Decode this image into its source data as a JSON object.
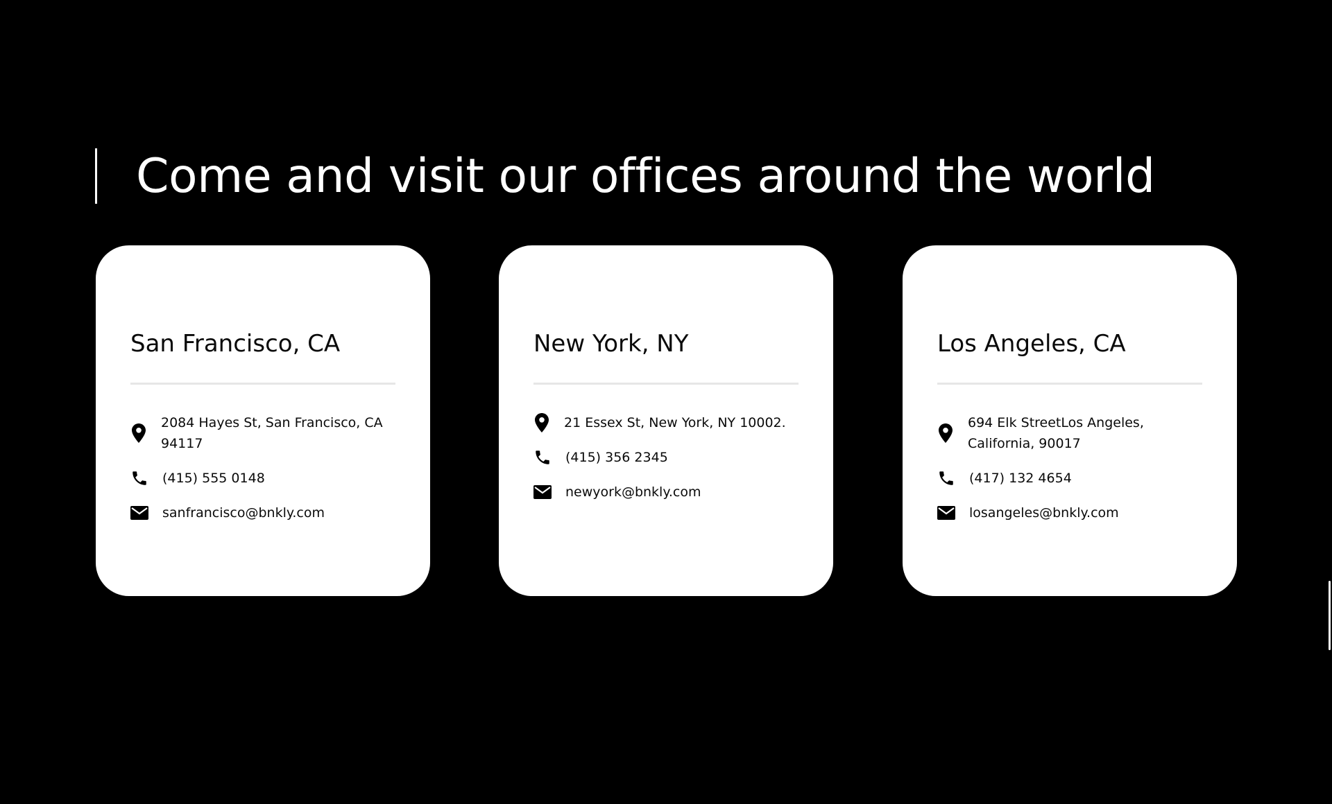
{
  "heading": "Come and visit our offices around the world",
  "offices": [
    {
      "city": "San Francisco, CA",
      "address": "2084 Hayes St, San Francisco, CA 94117",
      "phone": "(415) 555 0148",
      "email": "sanfrancisco@bnkly.com"
    },
    {
      "city": "New York, NY",
      "address": "21 Essex St, New York, NY 10002.",
      "phone": "(415) 356 2345",
      "email": "newyork@bnkly.com"
    },
    {
      "city": "Los Angeles, CA",
      "address": "694 Elk StreetLos Angeles, California, 90017",
      "phone": "(417) 132 4654",
      "email": "losangeles@bnkly.com"
    }
  ],
  "icons": {
    "address": "map-pin-icon",
    "phone": "phone-icon",
    "email": "envelope-icon"
  },
  "colors": {
    "background": "#000000",
    "card": "#ffffff",
    "text": "#0a0a0a",
    "divider": "#e6e6e6"
  }
}
